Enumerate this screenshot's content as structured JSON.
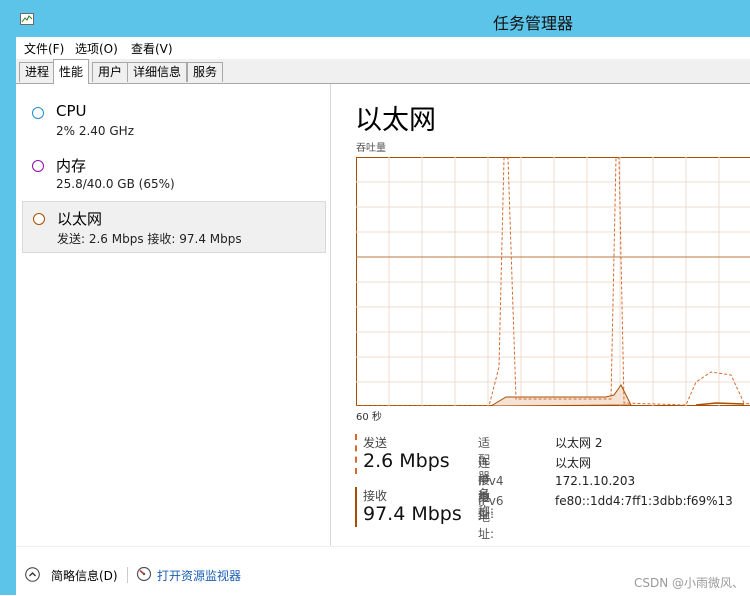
{
  "window": {
    "title": "任务管理器"
  },
  "menu": [
    "文件(F)",
    "选项(O)",
    "查看(V)"
  ],
  "tabs": [
    "进程",
    "性能",
    "用户",
    "详细信息",
    "服务"
  ],
  "active_tab": "性能",
  "resources": [
    {
      "name": "CPU",
      "sub": "2% 2.40 GHz",
      "color": "#1f8fd6",
      "selected": false
    },
    {
      "name": "内存",
      "sub": "25.8/40.0 GB (65%)",
      "color": "#8b12ae",
      "selected": false
    },
    {
      "name": "以太网",
      "sub": "发送: 2.6 Mbps 接收: 97.4 Mbps",
      "color": "#a74f01",
      "selected": true
    }
  ],
  "detail": {
    "title": "以太网",
    "graph_label": "吞吐量",
    "time_label": "60 秒",
    "send": {
      "label": "发送",
      "value": "2.6 Mbps",
      "color": "#d46a2f"
    },
    "recv": {
      "label": "接收",
      "value": "97.4 Mbps",
      "color": "#a74f01"
    },
    "info": [
      {
        "k": "适配器名称:",
        "v": "以太网 2"
      },
      {
        "k": "连接类型:",
        "v": "以太网"
      },
      {
        "k": "IPv4 地址:",
        "v": "172.1.10.203"
      },
      {
        "k": "IPv6 地址:",
        "v": "fe80::1dd4:7ff1:3dbb:f69%13"
      }
    ]
  },
  "footer": {
    "less": "简略信息(D)",
    "monitor": "打开资源监视器"
  },
  "watermark": "CSDN @小雨微风、"
}
